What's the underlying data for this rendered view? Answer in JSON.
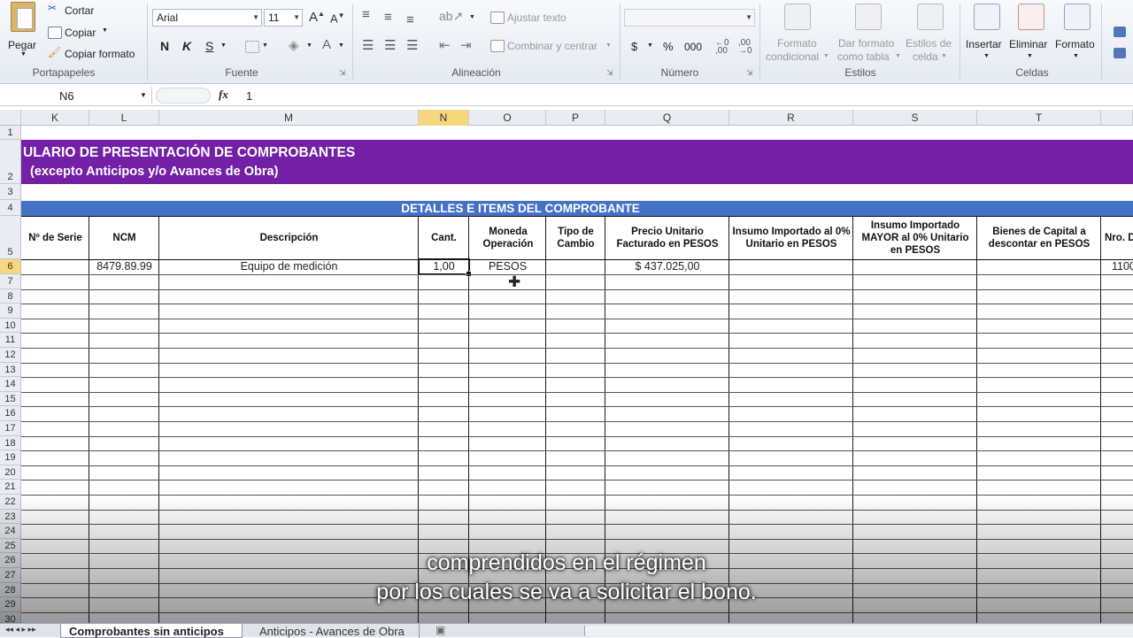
{
  "ribbon": {
    "portapapeles": {
      "paste": "Pegar",
      "cut": "Cortar",
      "copy": "Copiar",
      "copy_format": "Copiar formato",
      "label": "Portapapeles"
    },
    "fuente": {
      "font": "Arial",
      "size": "11",
      "bold": "N",
      "italic": "K",
      "underline": "S",
      "label": "Fuente"
    },
    "alineacion": {
      "wrap": "Ajustar texto",
      "merge": "Combinar y centrar",
      "label": "Alineación"
    },
    "numero": {
      "format": "",
      "currency": "$",
      "percent": "%",
      "thousands": "000",
      "label": "Número"
    },
    "estilos": {
      "cond_1": "Formato",
      "cond_2": "condicional",
      "table_1": "Dar formato",
      "table_2": "como tabla",
      "cell_1": "Estilos de",
      "cell_2": "celda",
      "label": "Estilos"
    },
    "celdas": {
      "insert": "Insertar",
      "delete": "Eliminar",
      "format": "Formato",
      "label": "Celdas"
    }
  },
  "formula_bar": {
    "name_box": "N6",
    "fx": "fx",
    "value": "1"
  },
  "columns": [
    "K",
    "L",
    "M",
    "N",
    "O",
    "P",
    "Q",
    "R",
    "S",
    "T"
  ],
  "selected_column": "N",
  "rows": [
    "1",
    "2",
    "3",
    "4",
    "5",
    "6",
    "7",
    "8",
    "9",
    "10",
    "11",
    "12",
    "13",
    "14",
    "15",
    "16",
    "17",
    "18",
    "19",
    "20",
    "21",
    "22",
    "23",
    "24",
    "25",
    "26",
    "27",
    "28",
    "29",
    "30"
  ],
  "sheet": {
    "title_line1": "ULARIO DE PRESENTACIÓN DE COMPROBANTES",
    "title_line2": "(excepto Anticipos y/o Avances de Obra)",
    "section_header": "DETALLES E ITEMS DEL COMPROBANTE",
    "headers": {
      "serie": "Nº de Serie",
      "ncm": "NCM",
      "desc": "Descripción",
      "cant": "Cant.",
      "moneda": "Moneda Operación",
      "tipo": "Tipo de Cambio",
      "precio": "Precio Unitario Facturado en PESOS",
      "insumo0": "Insumo Importado al 0% Unitario en PESOS",
      "insumoM": "Insumo Importado MAYOR al 0% Unitario en PESOS",
      "bienes": "Bienes de Capital a descontar en PESOS",
      "nro": "Nro. D"
    },
    "row6": {
      "ncm": "8479.89.99",
      "desc": "Equipo de medición",
      "cant": "1,00",
      "moneda": "PESOS",
      "precio": "$ 437.025,00",
      "nro": "1100"
    }
  },
  "tabs": {
    "active": "Comprobantes sin anticipos",
    "other": "Anticipos - Avances de Obra"
  },
  "subtitle": {
    "line1": "comprendidos en el régimen",
    "line2": "por los cuales se va a solicitar el bono."
  },
  "colors": {
    "purple": "#7320a6",
    "blue": "#4472c4",
    "select": "#f6d77d"
  }
}
